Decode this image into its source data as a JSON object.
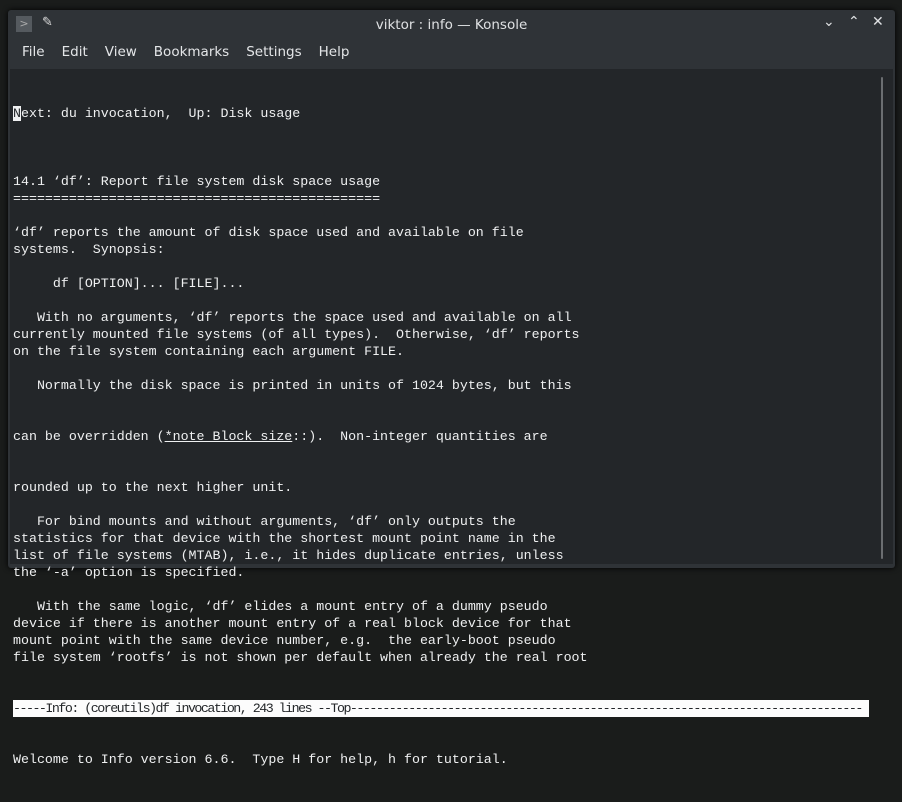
{
  "window": {
    "title": "viktor : info — Konsole",
    "minimize": "⌄",
    "maximize": "⌃",
    "close": "✕"
  },
  "menu": [
    "File",
    "Edit",
    "View",
    "Bookmarks",
    "Settings",
    "Help"
  ],
  "terminal": {
    "first_char": "N",
    "first_rest": "ext: du invocation,  Up: Disk usage",
    "lines": [
      "",
      "14.1 ‘df’: Report file system disk space usage",
      "==============================================",
      "",
      "‘df’ reports the amount of disk space used and available on file",
      "systems.  Synopsis:",
      "",
      "     df [OPTION]... [FILE]...",
      "",
      "   With no arguments, ‘df’ reports the space used and available on all",
      "currently mounted file systems (of all types).  Otherwise, ‘df’ reports",
      "on the file system containing each argument FILE.",
      "",
      "   Normally the disk space is printed in units of 1024 bytes, but this"
    ],
    "link_pre": "can be overridden (",
    "link": "*note Block size",
    "link_post": "::).  Non-integer quantities are",
    "lines2": [
      "rounded up to the next higher unit.",
      "",
      "   For bind mounts and without arguments, ‘df’ only outputs the",
      "statistics for that device with the shortest mount point name in the",
      "list of file systems (MTAB), i.e., it hides duplicate entries, unless",
      "the ‘-a’ option is specified.",
      "",
      "   With the same logic, ‘df’ elides a mount entry of a dummy pseudo",
      "device if there is another mount entry of a real block device for that",
      "mount point with the same device number, e.g.  the early-boot pseudo",
      "file system ‘rootfs’ is not shown per default when already the real root"
    ],
    "status_line": "-----Info: (coreutils)df invocation, 243 lines --Top-------------------------------------------------------------------------------",
    "echo_line": "Welcome to Info version 6.6.  Type H for help, h for tutorial."
  }
}
